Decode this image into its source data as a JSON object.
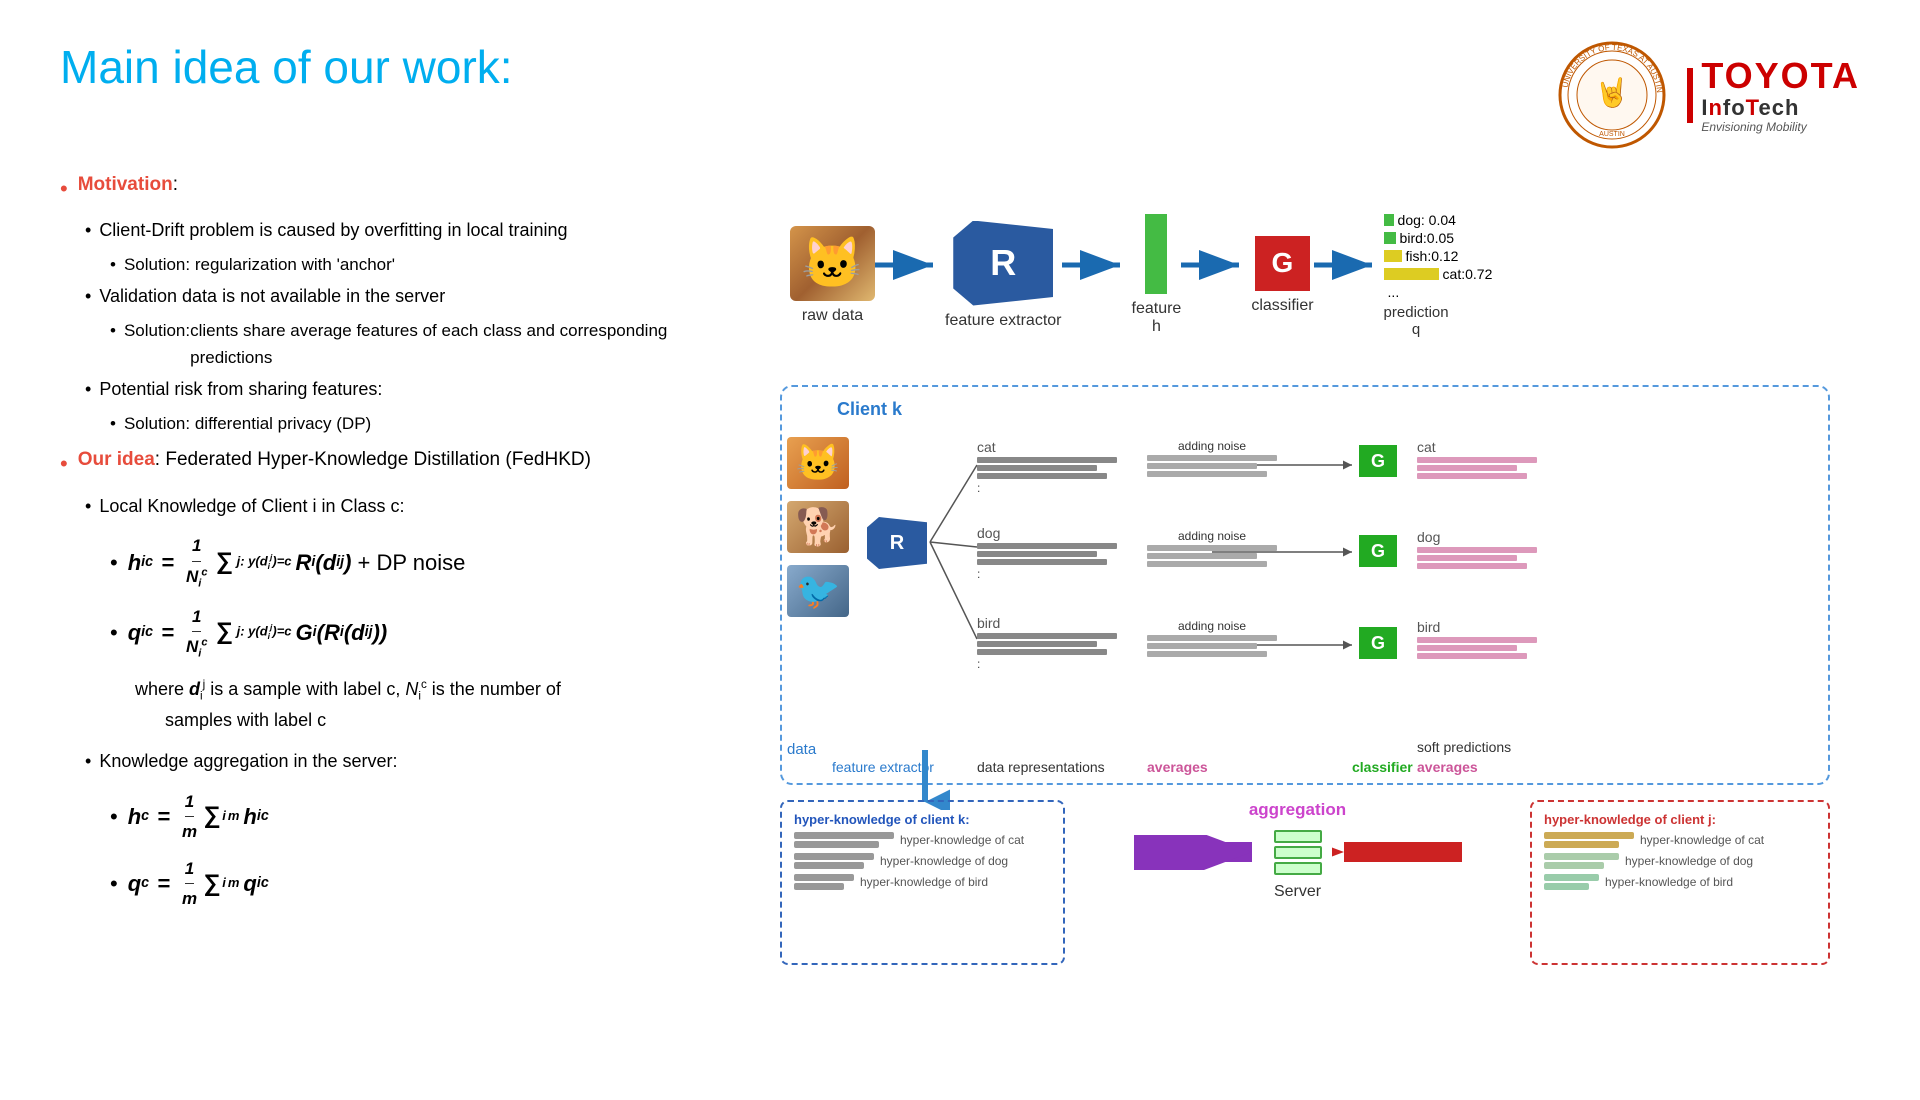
{
  "slide": {
    "title": "Main idea of our work:",
    "logos": {
      "ut": "UT Austin seal",
      "toyota": "TOYOTA",
      "infotech": "InfoTech",
      "tagline": "Envisioning Mobility"
    },
    "left": {
      "motivation_label": "Motivation",
      "motivation_colon": ":",
      "bullet1": "Client-Drift problem is caused by overfitting in local training",
      "solution1": "Solution: regularization with 'anchor'",
      "bullet2": "Validation data is not available in the server",
      "solution2": "clients share average features of each class and corresponding predictions",
      "solution2_prefix": "Solution:",
      "bullet3": "Potential risk from sharing features:",
      "solution3": "Solution: differential privacy (DP)",
      "our_idea_label": "Our idea",
      "our_idea_desc": ": Federated Hyper-Knowledge Distillation (FedHKD)",
      "local_knowledge": "Local Knowledge of Client i in Class c:",
      "formula_h_bullet": "•",
      "formula_h_lhs": "h",
      "formula_h_sub": "i",
      "formula_h_sup": "c",
      "formula_h_eq": "=",
      "formula_h_frac_num": "1",
      "formula_h_frac_den": "N",
      "formula_h_den_sub": "i",
      "formula_h_den_sup": "c",
      "formula_h_sum": "∑",
      "formula_h_sum_sub": "j: y(d",
      "formula_h_sum_sub2": "i",
      "formula_h_sum_sub3": ")=c",
      "formula_h_r": "R",
      "formula_h_r_sub": "i",
      "formula_h_r_arg": "(d",
      "formula_h_r_arg_sub": "i",
      "formula_h_r_arg_sup": "j",
      "formula_h_r_arg_end": ")",
      "formula_h_noise": "+ DP noise",
      "formula_q_lhs": "q",
      "formula_q_sub": "i",
      "formula_q_sup": "c",
      "formula_q_eq": "=",
      "formula_q_frac_num": "1",
      "formula_q_frac_den": "N",
      "formula_q_den_sub": "i",
      "formula_q_den_sup": "c",
      "formula_q_sum": "∑",
      "formula_q_g": "G",
      "formula_q_g_sub": "i",
      "where_text": "where d",
      "where_d_sub": "i",
      "where_d_sup": "j",
      "where_rest": "is a sample with label c, N",
      "where_n_sub": "i",
      "where_n_sup": "c",
      "where_end": "is the number of samples with label c",
      "knowledge_agg": "Knowledge aggregation in the server:",
      "formula_hc_lhs": "h",
      "formula_hc_sup": "c",
      "formula_hc_eq": "=",
      "formula_hc_frac_num": "1",
      "formula_hc_frac_den_m": "m",
      "formula_hc_sum": "∑",
      "formula_hc_sum_sub": "i",
      "formula_hc_sum_sup": "m",
      "formula_hc_h": "h",
      "formula_hc_h_sub": "i",
      "formula_hc_h_sup": "c",
      "formula_qc_lhs": "q",
      "formula_qc_sup": "c",
      "formula_qc_eq": "=",
      "formula_qc_frac_num": "1",
      "formula_qc_frac_den_m": "m",
      "formula_qc_sum": "∑",
      "formula_qc_sum_sub": "i",
      "formula_qc_sum_sup": "m",
      "formula_qc_q": "q",
      "formula_qc_q_sub": "i",
      "formula_qc_q_sup": "c"
    },
    "right": {
      "pipeline": {
        "raw_data": "raw data",
        "feature_extractor": "feature extractor",
        "feature_h": "feature\nh",
        "classifier": "classifier",
        "prediction_q": "prediction\nq",
        "r_label": "R",
        "g_label": "G",
        "predictions": [
          "dog: 0.04",
          "bird:0.05",
          "fish:0.12",
          "cat:0.72",
          "..."
        ]
      },
      "diagram": {
        "client_k": "Client k",
        "data_label": "data",
        "feature_extractor_label": "feature extractor",
        "r_label": "R",
        "rows": [
          {
            "label": "cat",
            "label_right": "cat"
          },
          {
            "label": "dog",
            "label_right": "dog"
          },
          {
            "label": "bird",
            "label_right": "bird"
          }
        ],
        "adding_noise": "adding noise",
        "data_representations": "data representations",
        "averages_left": "averages",
        "classifier_label": "classifier",
        "soft_predictions": "soft predictions",
        "averages_right": "averages"
      },
      "aggregation": {
        "aggregation_label": "aggregation",
        "server_label": "Server",
        "client_k_title": "hyper-knowledge of client k:",
        "client_j_title": "hyper-knowledge of client j:",
        "hk_cat": "hyper-knowledge of cat",
        "hk_dog": "hyper-knowledge of dog",
        "hk_bird": "hyper-knowledge of bird"
      }
    }
  }
}
